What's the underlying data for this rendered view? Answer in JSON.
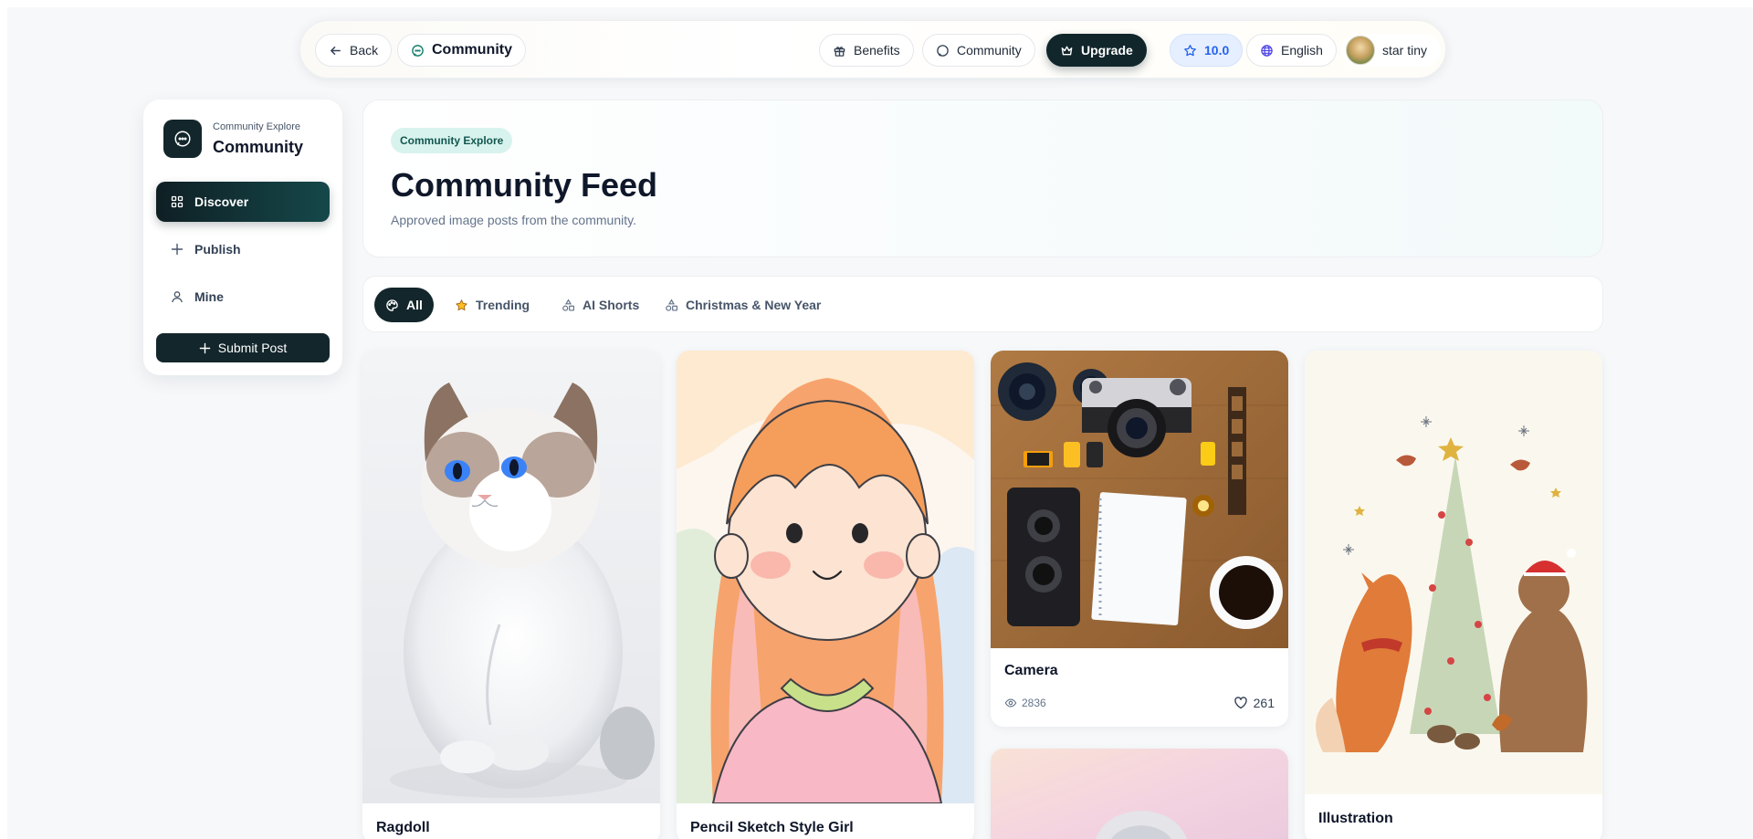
{
  "topnav": {
    "back_label": "Back",
    "title": "Community",
    "benefits_label": "Benefits",
    "community_label": "Community",
    "upgrade_label": "Upgrade",
    "credits": "10.0",
    "language": "English",
    "username": "star tiny"
  },
  "sidebar": {
    "brand_sub": "Community Explore",
    "brand_title": "Community",
    "items": [
      {
        "label": "Discover",
        "icon": "grid-icon",
        "active": true
      },
      {
        "label": "Publish",
        "icon": "plus-icon",
        "active": false
      },
      {
        "label": "Mine",
        "icon": "user-icon",
        "active": false
      }
    ],
    "submit_label": "Submit Post"
  },
  "hero": {
    "badge": "Community Explore",
    "title": "Community Feed",
    "subtitle": "Approved image posts from the community."
  },
  "tabs": [
    {
      "label": "All",
      "icon": "palette-icon",
      "active": true
    },
    {
      "label": "Trending",
      "icon": "star-icon",
      "active": false
    },
    {
      "label": "AI Shorts",
      "icon": "shapes-icon",
      "active": false
    },
    {
      "label": "Christmas & New Year",
      "icon": "shapes-icon",
      "active": false
    }
  ],
  "posts": [
    {
      "title": "Ragdoll"
    },
    {
      "title": "Pencil Sketch Style Girl"
    },
    {
      "title": "Camera",
      "views": "2836",
      "likes": "261"
    },
    {
      "title": ""
    },
    {
      "title": "Illustration"
    }
  ],
  "colors": {
    "primary_dark": "#13262b",
    "accent_teal": "#15484a",
    "credit_blue": "#2563eb",
    "badge_bg": "#d8f3ee"
  }
}
